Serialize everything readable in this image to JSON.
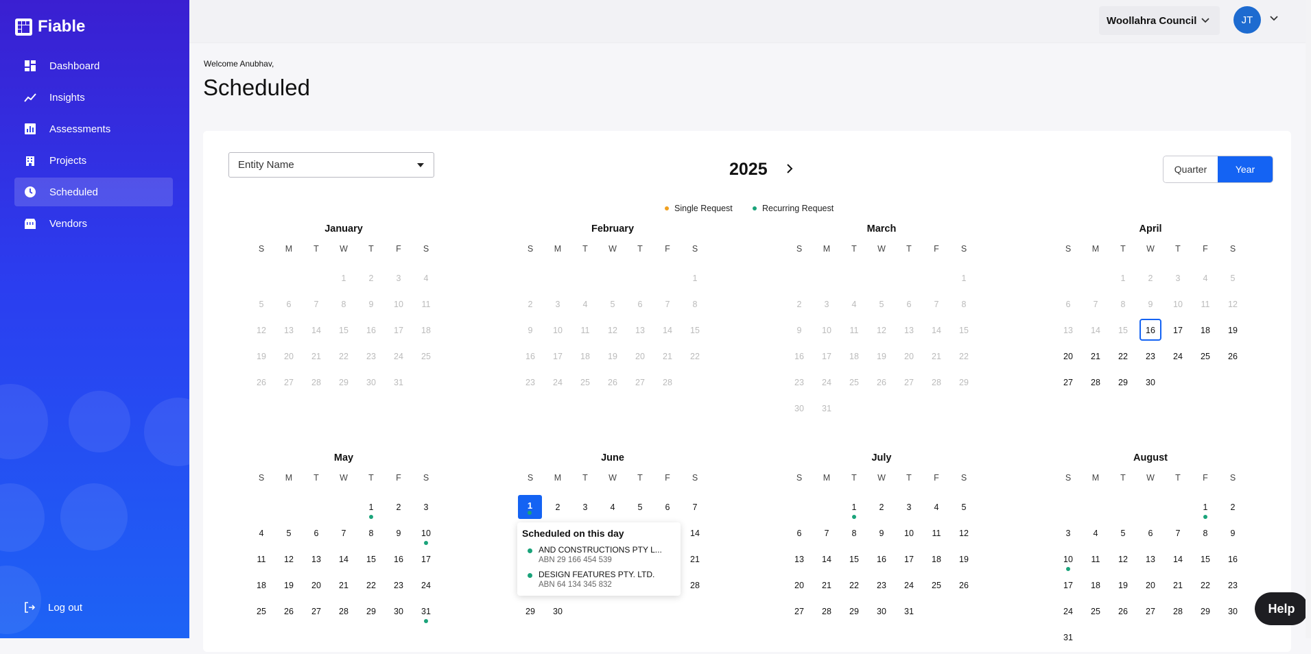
{
  "app": {
    "name": "Fiable"
  },
  "nav": [
    {
      "label": "Dashboard",
      "icon": "dashboard-icon"
    },
    {
      "label": "Insights",
      "icon": "insights-icon"
    },
    {
      "label": "Assessments",
      "icon": "assessments-icon"
    },
    {
      "label": "Projects",
      "icon": "projects-icon"
    },
    {
      "label": "Scheduled",
      "icon": "clock-icon",
      "active": true
    },
    {
      "label": "Vendors",
      "icon": "vendors-icon"
    }
  ],
  "logout_label": "Log out",
  "header": {
    "org": "Woollahra Council",
    "avatar_initials": "JT"
  },
  "welcome": "Welcome Anubhav,",
  "page_title": "Scheduled",
  "filters": {
    "entity_placeholder": "Entity Name",
    "year": "2025",
    "view_quarter": "Quarter",
    "view_year": "Year",
    "view_selected": "Year"
  },
  "legend": {
    "single": "Single Request",
    "single_color": "#f0a020",
    "recurring": "Recurring Request",
    "recurring_color": "#1aa37a"
  },
  "weekday_labels": [
    "S",
    "M",
    "T",
    "W",
    "T",
    "F",
    "S"
  ],
  "today": {
    "month": "April",
    "day": 16
  },
  "selected": {
    "month": "June",
    "day": 1
  },
  "months": [
    {
      "name": "January",
      "first_weekday": 3,
      "days": 31,
      "events": []
    },
    {
      "name": "February",
      "first_weekday": 6,
      "days": 28,
      "events": []
    },
    {
      "name": "March",
      "first_weekday": 6,
      "days": 31,
      "events": []
    },
    {
      "name": "April",
      "first_weekday": 2,
      "days": 30,
      "events": []
    },
    {
      "name": "May",
      "first_weekday": 4,
      "days": 31,
      "events": [
        1,
        10,
        31
      ]
    },
    {
      "name": "June",
      "first_weekday": 0,
      "days": 30,
      "events": [
        1
      ]
    },
    {
      "name": "July",
      "first_weekday": 2,
      "days": 31,
      "events": [
        1
      ]
    },
    {
      "name": "August",
      "first_weekday": 5,
      "days": 31,
      "events": [
        1,
        10
      ]
    }
  ],
  "popover": {
    "title": "Scheduled on this day",
    "entries": [
      {
        "name": "AND CONSTRUCTIONS PTY L...",
        "abn": "ABN 29 166 454 539"
      },
      {
        "name": "DESIGN FEATURES PTY. LTD.",
        "abn": "ABN 64 134 345 832"
      }
    ]
  },
  "help_label": "Help"
}
